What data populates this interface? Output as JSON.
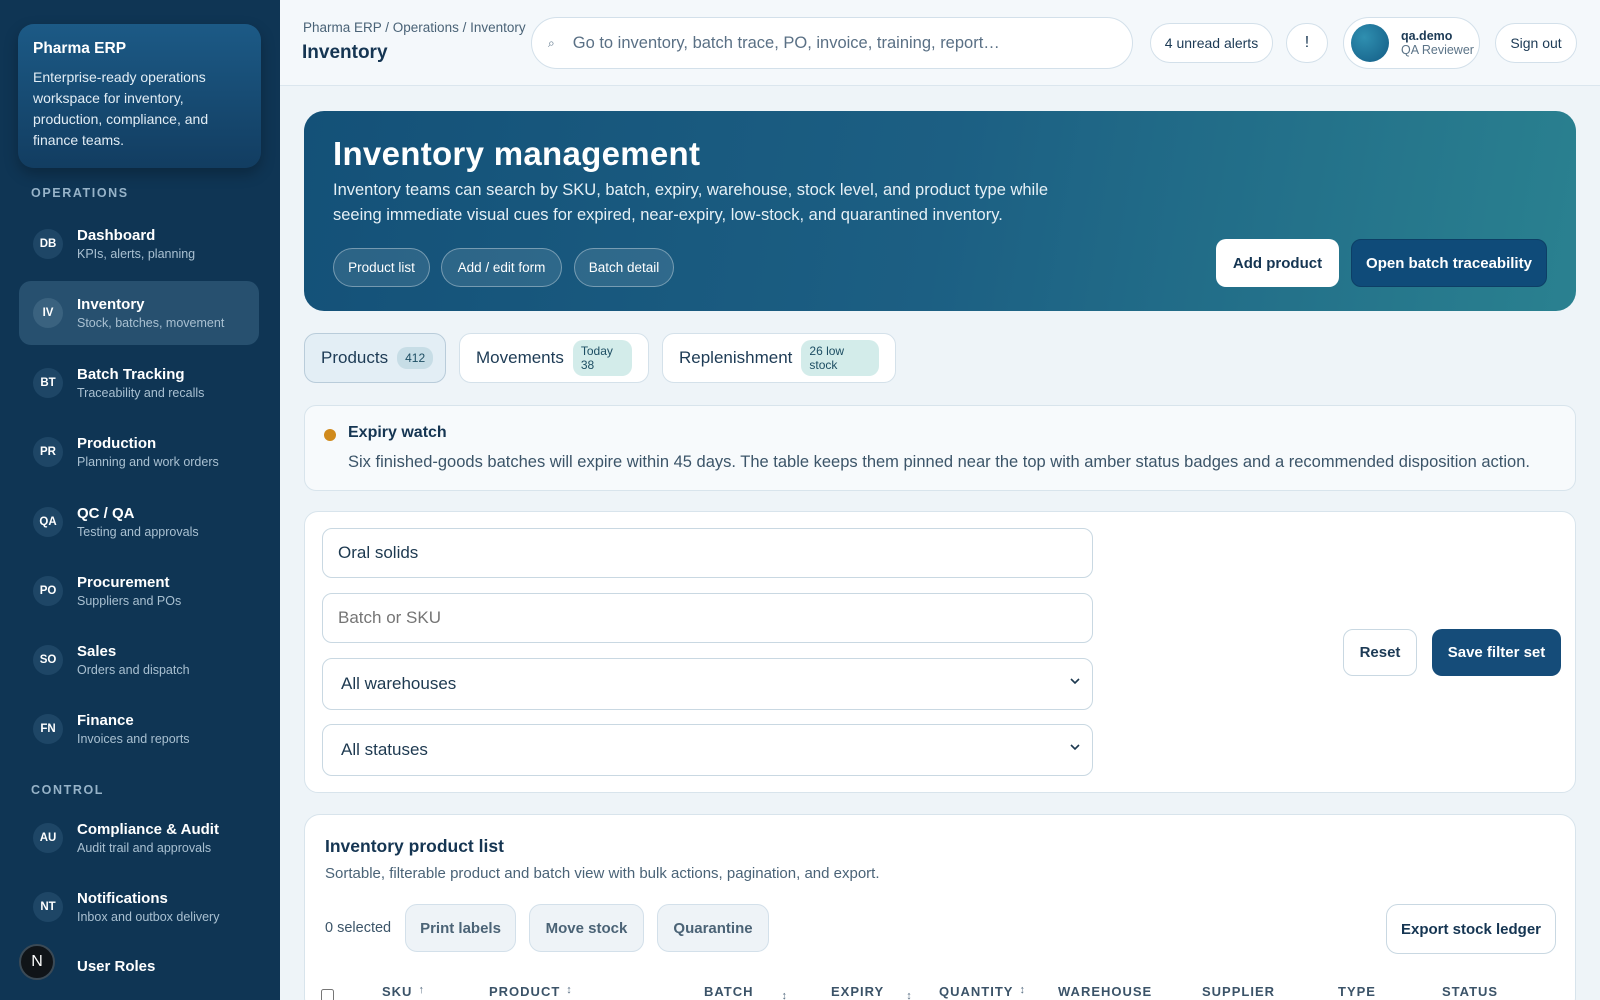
{
  "sidebar": {
    "brand_title": "Pharma ERP",
    "brand_desc": "Enterprise-ready operations workspace for inventory, production, compliance, and finance teams.",
    "section_operations": "OPERATIONS",
    "section_control": "CONTROL",
    "items": [
      {
        "badge": "DB",
        "label": "Dashboard",
        "sub": "KPIs, alerts, planning"
      },
      {
        "badge": "IV",
        "label": "Inventory",
        "sub": "Stock, batches, movement"
      },
      {
        "badge": "BT",
        "label": "Batch Tracking",
        "sub": "Traceability and recalls"
      },
      {
        "badge": "PR",
        "label": "Production",
        "sub": "Planning and work orders"
      },
      {
        "badge": "QA",
        "label": "QC / QA",
        "sub": "Testing and approvals"
      },
      {
        "badge": "PO",
        "label": "Procurement",
        "sub": "Suppliers and POs"
      },
      {
        "badge": "SO",
        "label": "Sales",
        "sub": "Orders and dispatch"
      },
      {
        "badge": "FN",
        "label": "Finance",
        "sub": "Invoices and reports"
      },
      {
        "badge": "AU",
        "label": "Compliance & Audit",
        "sub": "Audit trail and approvals"
      },
      {
        "badge": "NT",
        "label": "Notifications",
        "sub": "Inbox and outbox delivery"
      },
      {
        "badge": "",
        "label": "User Roles",
        "sub": ""
      }
    ],
    "floating_badge": "N"
  },
  "header": {
    "breadcrumb": "Pharma ERP / Operations / Inventory",
    "title": "Inventory",
    "search_placeholder": "Go to inventory, batch trace, PO, invoice, training, report…",
    "search_icon": "⌕",
    "alerts_label": "4 unread alerts",
    "alert_icon_label": "!",
    "user_name": "qa.demo",
    "user_role": "QA Reviewer",
    "sign_out": "Sign out"
  },
  "hero": {
    "title": "Inventory management",
    "description": "Inventory teams can search by SKU, batch, expiry, warehouse, stock level, and product type while seeing immediate visual cues for expired, near-expiry, low-stock, and quarantined inventory.",
    "chips": [
      "Product list",
      "Add / edit form",
      "Batch detail"
    ],
    "add_product": "Add product",
    "open_batch": "Open batch traceability"
  },
  "tabs": [
    {
      "label": "Products",
      "badge": "412"
    },
    {
      "label": "Movements",
      "badge": "Today 38"
    },
    {
      "label": "Replenishment",
      "badge": "26 low stock"
    }
  ],
  "alert": {
    "title": "Expiry watch",
    "text": "Six finished-goods batches will expire within 45 days. The table keeps them pinned near the top with amber status badges and a recommended disposition action.",
    "dot_color": "#d08a1c"
  },
  "filters": {
    "product_type_value": "Oral solids",
    "batch_placeholder": "Batch or SKU",
    "warehouse_value": "All warehouses",
    "status_value": "All statuses",
    "reset": "Reset",
    "save": "Save filter set"
  },
  "list": {
    "title": "Inventory product list",
    "subtitle": "Sortable, filterable product and batch view with bulk actions, pagination, and export.",
    "selected": "0 selected",
    "bulk_actions": [
      "Print labels",
      "Move stock",
      "Quarantine"
    ],
    "export": "Export stock ledger",
    "columns": [
      "SKU",
      "PRODUCT",
      "BATCH",
      "EXPIRY",
      "QUANTITY",
      "WAREHOUSE",
      "SUPPLIER",
      "TYPE",
      "STATUS"
    ],
    "sort_up": "↑",
    "sort_both": "↕"
  },
  "colors": {
    "sidebar_bg": "#0f3554",
    "accent": "#154c79",
    "amber": "#d08a1c"
  }
}
